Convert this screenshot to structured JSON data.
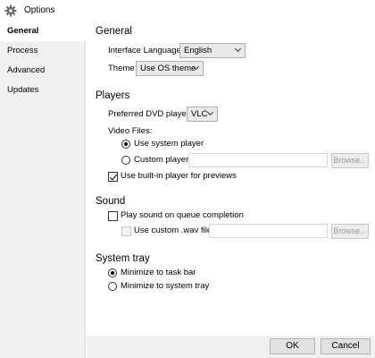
{
  "window": {
    "title": "Options",
    "icon": "gear-icon"
  },
  "sidebar": {
    "items": [
      {
        "label": "General",
        "active": true
      },
      {
        "label": "Process",
        "active": false
      },
      {
        "label": "Advanced",
        "active": false
      },
      {
        "label": "Updates",
        "active": false
      }
    ]
  },
  "general": {
    "title": "General",
    "language_label": "Interface Language:",
    "language_value": "English",
    "theme_label": "Theme",
    "theme_value": "Use OS theme"
  },
  "players": {
    "title": "Players",
    "dvd_label": "Preferred DVD player:",
    "dvd_value": "VLC",
    "video_files_label": "Video Files:",
    "use_system_label": "Use system player",
    "use_system_checked": true,
    "custom_player_label": "Custom player:",
    "custom_player_value": "",
    "browse_label": "Browse...",
    "builtin_label": "Use built-in player for previews",
    "builtin_checked": true
  },
  "sound": {
    "title": "Sound",
    "play_sound_label": "Play sound on queue completion",
    "play_sound_checked": false,
    "custom_wav_label": "Use custom .wav file:",
    "custom_wav_checked": false,
    "custom_wav_value": "",
    "browse_label": "Browse..."
  },
  "system_tray": {
    "title": "System tray",
    "minimize_taskbar_label": "Minimize to task bar",
    "minimize_taskbar_checked": true,
    "minimize_tray_label": "Minimize to system tray",
    "minimize_tray_checked": false
  },
  "footer": {
    "ok_label": "OK",
    "cancel_label": "Cancel"
  }
}
